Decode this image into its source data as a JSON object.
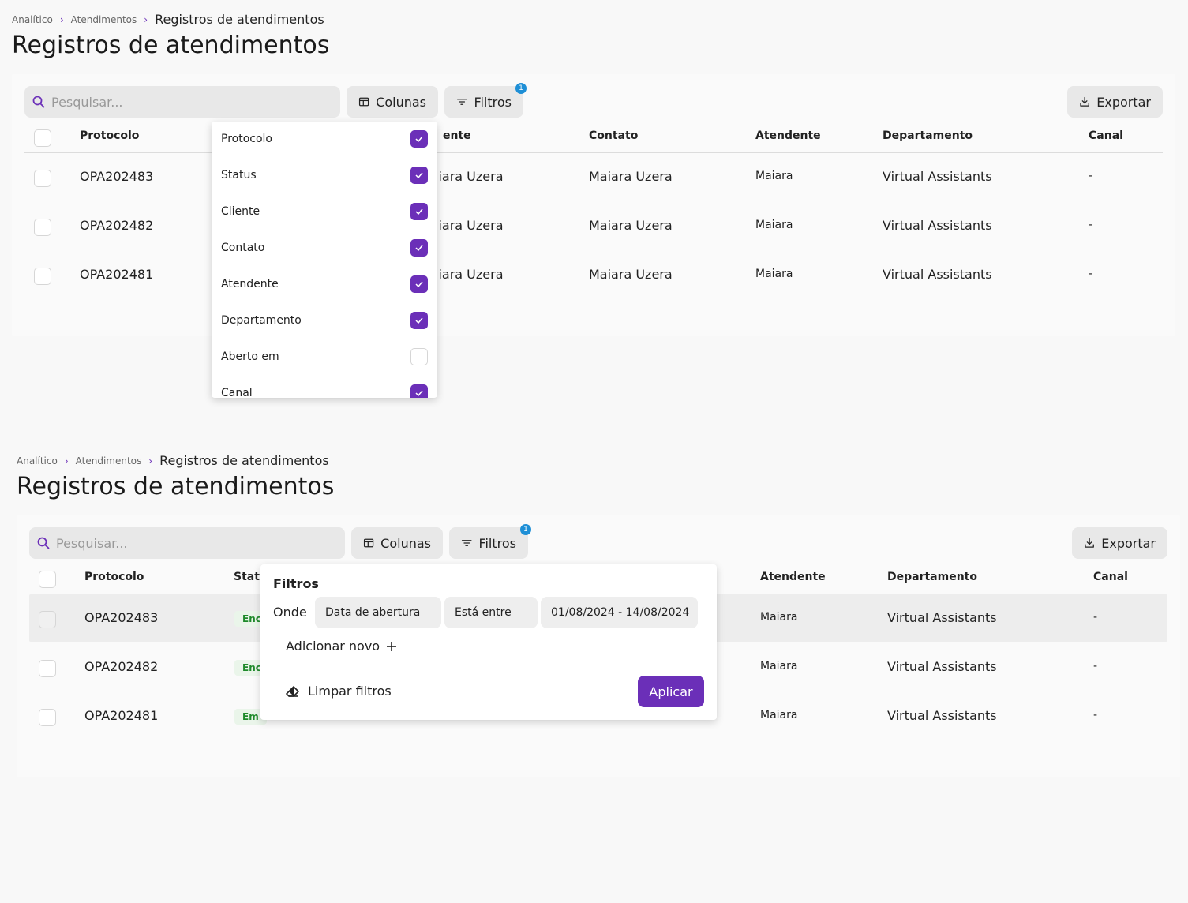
{
  "breadcrumb": {
    "items": [
      "Analítico",
      "Atendimentos"
    ],
    "current": "Registros de atendimentos"
  },
  "page_title": "Registros de atendimentos",
  "toolbar": {
    "search_placeholder": "Pesquisar...",
    "columns_label": "Colunas",
    "filters_label": "Filtros",
    "filters_count": "1",
    "export_label": "Exportar"
  },
  "table": {
    "headers": {
      "protocolo": "Protocolo",
      "status_partial": "Statu",
      "cliente_partial": "ente",
      "contato": "Contato",
      "atendente": "Atendente",
      "departamento": "Departamento",
      "canal": "Canal"
    },
    "rows": [
      {
        "protocolo": "OPA202483",
        "status_partial": "Enc",
        "cliente_partial": "iiara Uzera",
        "contato": "Maiara Uzera",
        "atendente": "Maiara",
        "departamento": "Virtual Assistants",
        "canal": "-"
      },
      {
        "protocolo": "OPA202482",
        "status_partial": "Enc",
        "cliente_partial": "iiara Uzera",
        "contato": "Maiara Uzera",
        "atendente": "Maiara",
        "departamento": "Virtual Assistants",
        "canal": "-"
      },
      {
        "protocolo": "OPA202481",
        "status_partial": "Em",
        "cliente_partial": "iiara Uzera",
        "contato": "Maiara Uzera",
        "atendente": "Maiara",
        "departamento": "Virtual Assistants",
        "canal": "-"
      }
    ]
  },
  "columns_menu": {
    "items": [
      {
        "label": "Protocolo",
        "checked": true
      },
      {
        "label": "Status",
        "checked": true
      },
      {
        "label": "Cliente",
        "checked": true
      },
      {
        "label": "Contato",
        "checked": true
      },
      {
        "label": "Atendente",
        "checked": true
      },
      {
        "label": "Departamento",
        "checked": true
      },
      {
        "label": "Aberto em",
        "checked": false
      },
      {
        "label": "Canal",
        "checked": true
      }
    ]
  },
  "filter_popover": {
    "title": "Filtros",
    "where_label": "Onde",
    "field_value": "Data de abertura",
    "operator_value": "Está entre",
    "range_value": "01/08/2024 - 14/08/2024",
    "add_new_label": "Adicionar novo",
    "clear_label": "Limpar filtros",
    "apply_label": "Aplicar"
  },
  "colors": {
    "accent": "#6b2fb8",
    "badge": "#1e8fd6",
    "status_green": "#1e8a2a"
  }
}
